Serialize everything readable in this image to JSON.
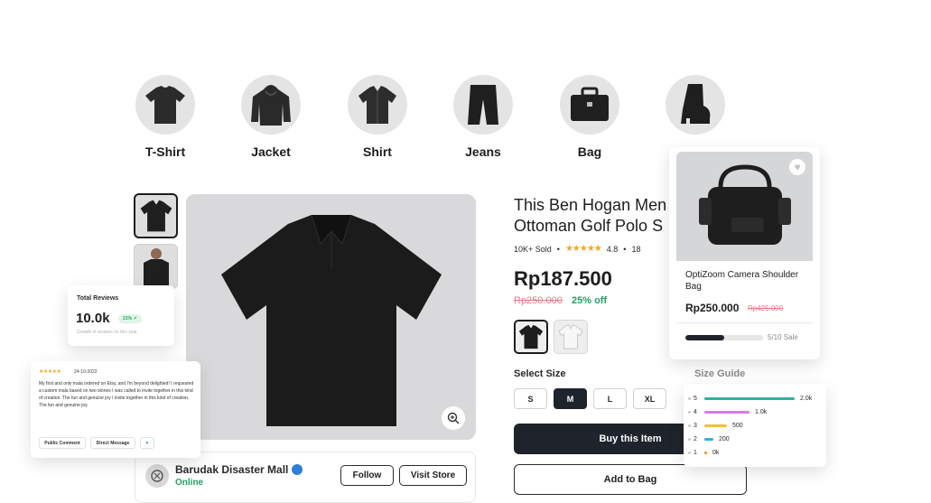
{
  "categories": [
    {
      "label": "T-Shirt",
      "icon": "tshirt-icon"
    },
    {
      "label": "Jacket",
      "icon": "hoodie-icon"
    },
    {
      "label": "Shirt",
      "icon": "shirt-icon"
    },
    {
      "label": "Jeans",
      "icon": "shorts-icon"
    },
    {
      "label": "Bag",
      "icon": "briefcase-icon"
    },
    {
      "label": "",
      "icon": "boot-icon"
    }
  ],
  "product": {
    "title_line1": "This Ben Hogan Men",
    "title_line2": "Ottoman Golf Polo S",
    "sold": "10K+ Sold",
    "rating": "4.8",
    "reviews_partial": "18",
    "price": "Rp187.500",
    "old_price": "Rp250.000",
    "discount": "25% off",
    "select_size_label": "Select Size",
    "size_guide_label": "Size Guide",
    "sizes": [
      "S",
      "M",
      "L",
      "XL"
    ],
    "selected_size": "M",
    "buy_label": "Buy this Item",
    "add_label": "Add to Bag",
    "colors": [
      "#1d1d1d",
      "#f2f2f2"
    ]
  },
  "seller": {
    "name": "Barudak Disaster Mall",
    "status": "Online",
    "follow_label": "Follow",
    "visit_label": "Visit Store"
  },
  "reviews_summary": {
    "label": "Total Reviews",
    "value": "10.0k",
    "growth_badge": "21% ↗",
    "subtitle": "Growth in reviews on this year"
  },
  "comment": {
    "stars": "★★★★★",
    "date": "24-10-2022",
    "text": "My first and only mala ordered on Etsy, and I'm beyond delighted! I requested a custom mala based on two stones I was called to invite together in this kind of creation. The fun and genuine joy I invite together in this kind of creation.",
    "text2": "The fun and genuine joy.",
    "public_label": "Public Comment",
    "direct_label": "Direct Message"
  },
  "featured": {
    "name": "OptiZoom Camera Shoulder Bag",
    "price": "Rp250.000",
    "old_price": "Rp425.000",
    "sold_count": 5,
    "sold_total": 10,
    "sale_label": "5/10 Sale"
  },
  "rating_breakdown": [
    {
      "stars": "5",
      "count": "2.0k",
      "value": 2000,
      "color": "#2ab3a0"
    },
    {
      "stars": "4",
      "count": "1.0k",
      "value": 1000,
      "color": "#d77be6"
    },
    {
      "stars": "3",
      "count": "500",
      "value": 500,
      "color": "#f2c12e"
    },
    {
      "stars": "2",
      "count": "200",
      "value": 200,
      "color": "#2bb7d6"
    },
    {
      "stars": "1",
      "count": "0k",
      "value": 0,
      "color": "#f08a2c"
    }
  ],
  "colors": {
    "dark": "#1f232b",
    "accent_green": "#22a064",
    "strike_red": "#e57b8a",
    "star": "#f5a623"
  }
}
